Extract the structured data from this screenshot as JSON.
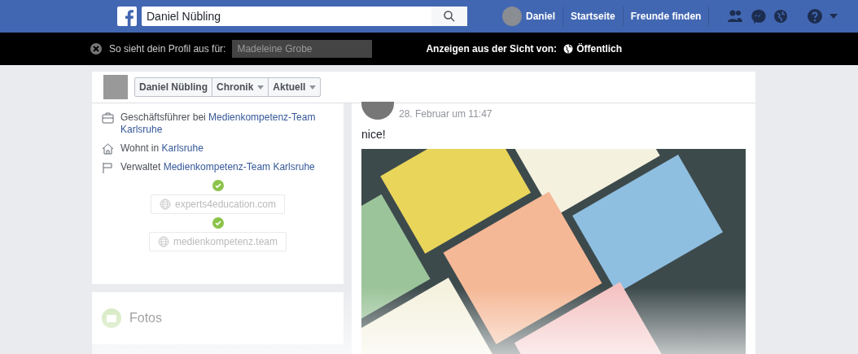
{
  "top_bar": {
    "search": {
      "value": "Daniel Nübling"
    },
    "profile_name": "Daniel",
    "links": [
      "Startseite",
      "Freunde finden"
    ]
  },
  "view_as_bar": {
    "label": "So sieht dein Profil aus für:",
    "viewer_field": {
      "placeholder": "Madeleine Grobe"
    },
    "view_from_label": "Anzeigen aus der Sicht von:",
    "audience": "Öffentlich"
  },
  "profile_header": {
    "name": "Daniel Nübling",
    "menus": [
      "Chronik",
      "Aktuell"
    ]
  },
  "intro": {
    "items": [
      {
        "kind": "work",
        "text": "Geschäftsführer bei",
        "link": "Medienkompetenz-Team Karlsruhe"
      },
      {
        "kind": "home",
        "text": "Wohnt in",
        "link": "Karlsruhe"
      },
      {
        "kind": "page",
        "text": "Verwaltet",
        "link": "Medienkompetenz-Team Karlsruhe"
      }
    ],
    "websites": [
      {
        "url": "experts4education.com",
        "verified": true
      },
      {
        "url": "medienkompetenz.team",
        "verified": true
      }
    ]
  },
  "photos": {
    "title": "Fotos"
  },
  "post": {
    "time": "28. Februar um 11:47",
    "text": "nice!"
  }
}
